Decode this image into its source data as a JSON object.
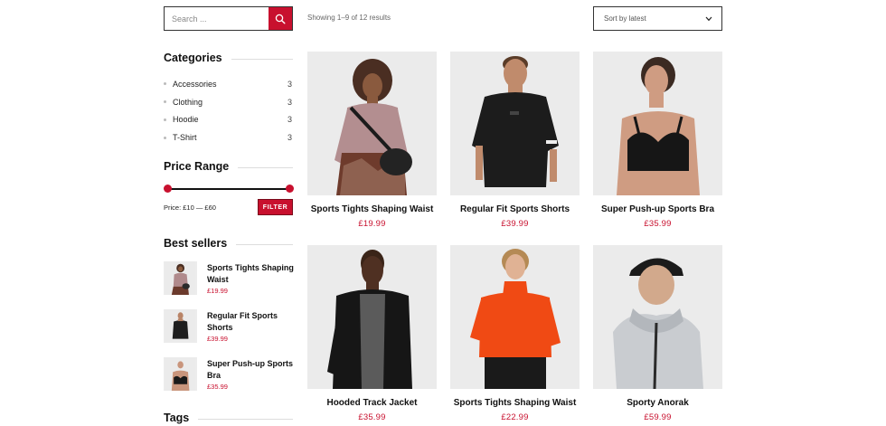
{
  "search": {
    "placeholder": "Search ..."
  },
  "results_text": "Showing 1–9 of 12 results",
  "sort": {
    "selected": "Sort by latest"
  },
  "categories": {
    "title": "Categories",
    "items": [
      {
        "label": "Accessories",
        "count": "3"
      },
      {
        "label": "Clothing",
        "count": "3"
      },
      {
        "label": "Hoodie",
        "count": "3"
      },
      {
        "label": "T-Shirt",
        "count": "3"
      }
    ]
  },
  "price_range": {
    "title": "Price Range",
    "label": "Price: £10 — £60",
    "filter_label": "FILTER"
  },
  "best_sellers": {
    "title": "Best sellers",
    "items": [
      {
        "title": "Sports Tights Shaping Waist",
        "price": "£19.99"
      },
      {
        "title": "Regular Fit Sports Shorts",
        "price": "£39.99"
      },
      {
        "title": "Super Push-up Sports Bra",
        "price": "£35.99"
      }
    ]
  },
  "tags": {
    "title": "Tags"
  },
  "products": [
    {
      "name": "Sports Tights Shaping Waist",
      "price": "£19.99",
      "image": "woman-mauve-top-photo"
    },
    {
      "name": "Regular Fit Sports Shorts",
      "price": "£39.99",
      "image": "man-black-tee-photo"
    },
    {
      "name": "Super Push-up Sports Bra",
      "price": "£35.99",
      "image": "woman-sports-bra-photo"
    },
    {
      "name": "Hooded Track Jacket",
      "price": "£35.99",
      "image": "man-black-jacket-photo"
    },
    {
      "name": "Sports Tights Shaping Waist",
      "price": "£22.99",
      "image": "woman-orange-pullover-photo"
    },
    {
      "name": "Sporty Anorak",
      "price": "£59.99",
      "image": "man-grey-anorak-photo"
    }
  ],
  "colors": {
    "accent": "#c8102e",
    "image_bg": "#ebebeb"
  }
}
